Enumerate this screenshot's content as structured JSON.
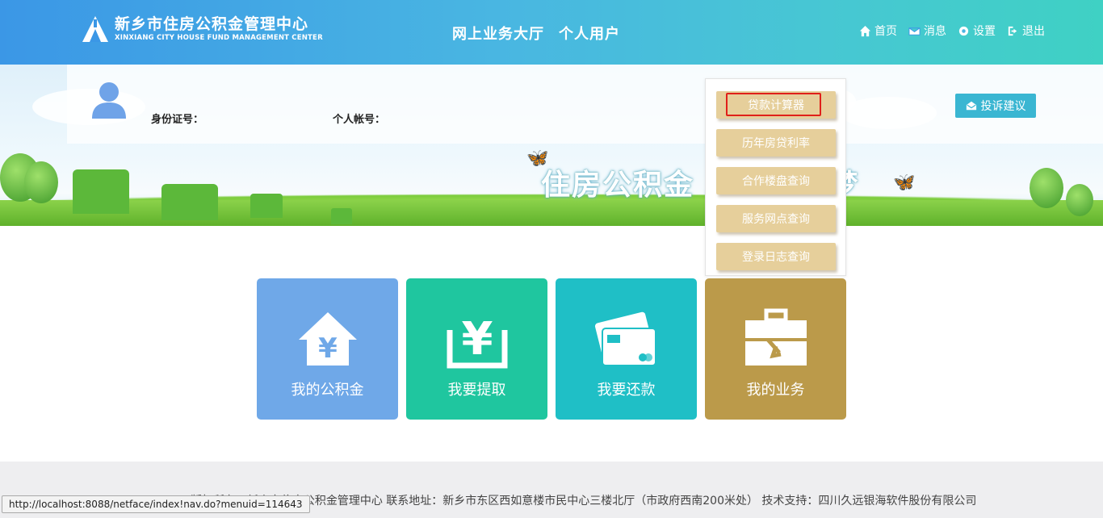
{
  "header": {
    "logo_cn": "新乡市住房公积金管理中心",
    "logo_en": "XINXIANG CITY HOUSE FUND MANAGEMENT CENTER",
    "center_title": "网上业务大厅",
    "user_type": "个人用户",
    "nav": [
      {
        "label": "首页",
        "icon": "home-icon"
      },
      {
        "label": "消息",
        "icon": "envelope-icon"
      },
      {
        "label": "设置",
        "icon": "gear-icon"
      },
      {
        "label": "退出",
        "icon": "logout-icon"
      }
    ]
  },
  "banner": {
    "slogan": "住房公积金 助圆安居梦"
  },
  "profile": {
    "id_label": "身份证号：",
    "account_label": "个人帐号：",
    "complaint_button": "投诉建议"
  },
  "dropdown": {
    "items": [
      "贷款计算器",
      "历年房贷利率",
      "合作楼盘查询",
      "服务网点查询",
      "登录日志查询"
    ],
    "highlighted": "贷款计算器"
  },
  "tiles": [
    {
      "label": "我的公积金",
      "icon": "house-yen-icon",
      "color": "#6fa8e8"
    },
    {
      "label": "我要提取",
      "icon": "yen-withdraw-icon",
      "color": "#1fc69f"
    },
    {
      "label": "我要还款",
      "icon": "cards-icon",
      "color": "#1fbfc6"
    },
    {
      "label": "我的业务",
      "icon": "toolbox-icon",
      "color": "#bb9a4a"
    }
  ],
  "footer": {
    "text": "©slis      版权所有：新乡市住房公积金管理中心 联系地址：新乡市东区西如意楼市民中心三楼北厅（市政府西南200米处） 技术支持：四川久远银海软件股份有限公司"
  },
  "status_bar": {
    "url": "http://localhost:8088/netface/index!nav.do?menuid=114643"
  }
}
